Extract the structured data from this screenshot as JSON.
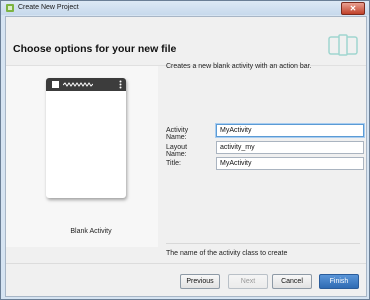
{
  "window": {
    "title": "Create New Project",
    "close_label": "✕"
  },
  "header": {
    "title": "Choose options for your new file"
  },
  "preview": {
    "caption": "Blank Activity"
  },
  "description": "Creates a new blank activity with an action bar.",
  "form": {
    "fields": [
      {
        "label": "Activity Name:",
        "value": "MyActivity"
      },
      {
        "label": "Layout Name:",
        "value": "activity_my"
      },
      {
        "label": "Title:",
        "value": "MyActivity"
      }
    ]
  },
  "hint": "The name of the activity class to create",
  "buttons": {
    "previous": "Previous",
    "next": "Next",
    "cancel": "Cancel",
    "finish": "Finish"
  },
  "colors": {
    "accent": "#2f6bb3",
    "focus": "#5b9bd5"
  }
}
